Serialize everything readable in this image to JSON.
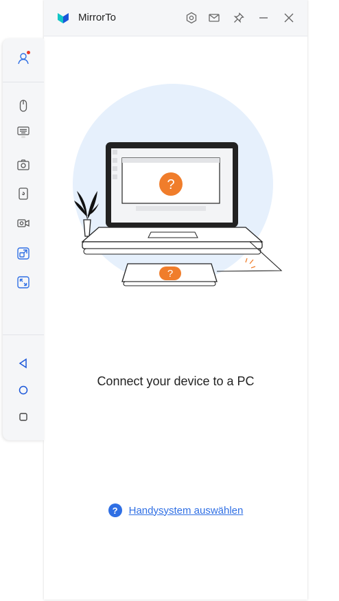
{
  "window": {
    "title": "MirrorTo",
    "controls": [
      "settings-icon",
      "mail-icon",
      "pin-icon",
      "minimize-icon",
      "close-icon"
    ]
  },
  "sidebar": {
    "items": [
      {
        "name": "account-icon",
        "has_notification": true
      },
      {
        "name": "mouse-icon"
      },
      {
        "name": "keyboard-icon"
      },
      {
        "name": "camera-icon"
      },
      {
        "name": "phone-screen-icon"
      },
      {
        "name": "video-record-icon"
      },
      {
        "name": "rotate-window-icon"
      },
      {
        "name": "fullscreen-icon"
      },
      {
        "name": "back-triangle-icon"
      },
      {
        "name": "home-circle-icon"
      },
      {
        "name": "recent-square-icon"
      }
    ]
  },
  "main": {
    "connect_text": "Connect your device to a PC",
    "help_icon": "?",
    "help_link": "Handysystem auswählen"
  },
  "colors": {
    "accent": "#2f6fe4",
    "orange": "#f07d2b",
    "titlebar": "#f5f6f8",
    "notification": "#e8392b",
    "illustration_bg": "#e6f0fc"
  }
}
